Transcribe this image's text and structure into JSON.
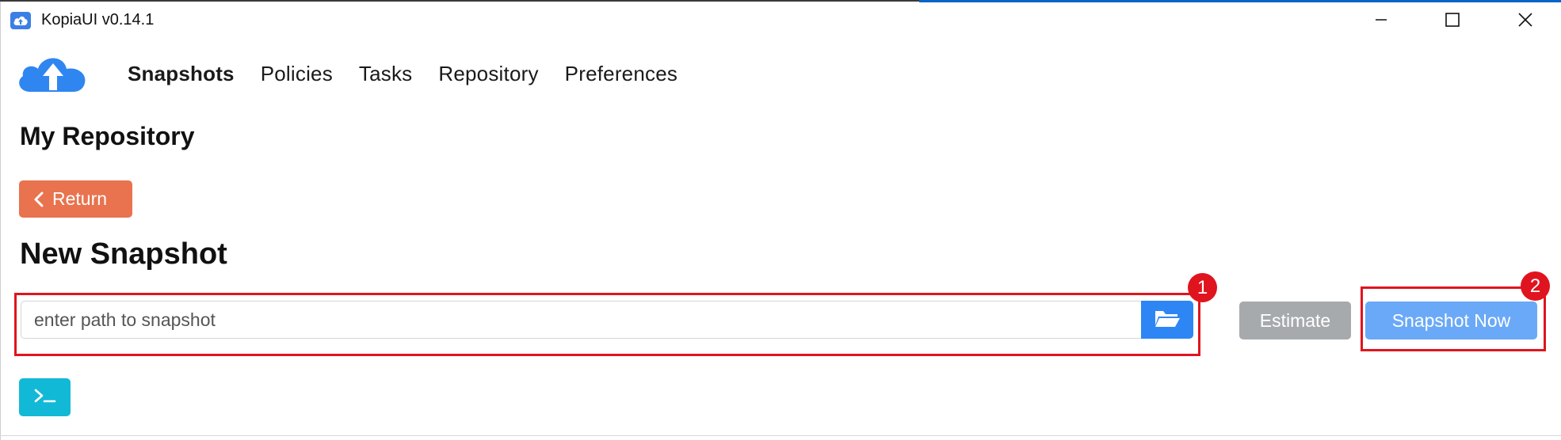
{
  "window": {
    "title": "KopiaUI v0.14.1"
  },
  "nav": {
    "items": [
      {
        "label": "Snapshots",
        "active": true
      },
      {
        "label": "Policies",
        "active": false
      },
      {
        "label": "Tasks",
        "active": false
      },
      {
        "label": "Repository",
        "active": false
      },
      {
        "label": "Preferences",
        "active": false
      }
    ]
  },
  "page": {
    "repository_name": "My Repository",
    "return_label": "Return",
    "section_title": "New Snapshot"
  },
  "snapshot_form": {
    "path_placeholder": "enter path to snapshot",
    "path_value": "",
    "estimate_label": "Estimate",
    "snapshot_now_label": "Snapshot Now"
  },
  "annotations": {
    "badge_1": "1",
    "badge_2": "2"
  },
  "colors": {
    "return_button": "#e8734e",
    "primary": "#2e86f5",
    "snapshot_now": "#6aa9f7",
    "estimate": "#a7aaad",
    "terminal": "#12b9d6",
    "annotation": "#e0141e",
    "logo": "#2f86f0"
  },
  "icons": {
    "app": "cloud-upload-icon",
    "logo": "cloud-upload-icon",
    "minimize": "minimize-icon",
    "maximize": "maximize-icon",
    "close": "close-icon",
    "return": "chevron-left-icon",
    "browse": "folder-open-icon",
    "terminal": "terminal-icon"
  }
}
